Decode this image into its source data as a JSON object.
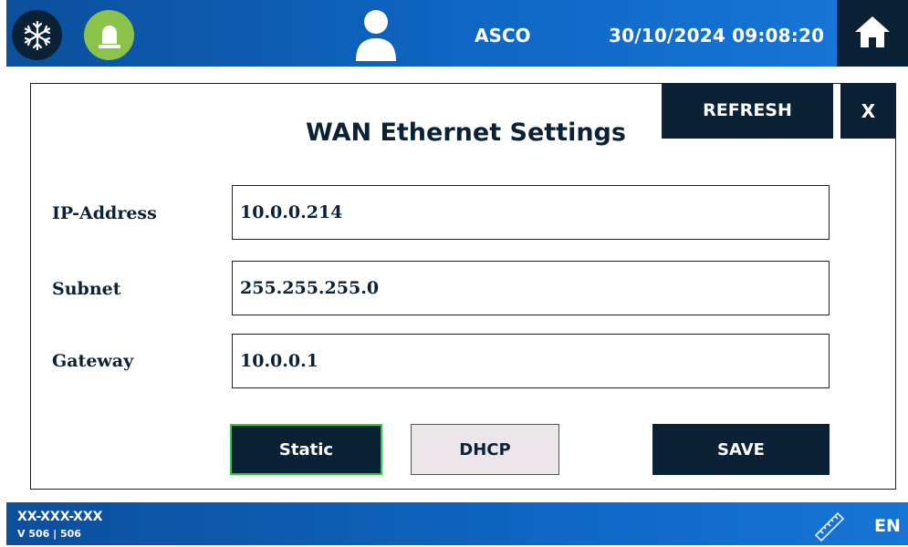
{
  "header": {
    "icons": [
      "snowflake-icon",
      "alarm-beacon-icon",
      "user-icon",
      "home-icon"
    ],
    "site_name": "ASCO",
    "datetime": "30/10/2024 09:08:20"
  },
  "dialog": {
    "title": "WAN Ethernet Settings",
    "refresh_label": "REFRESH",
    "close_label": "X",
    "fields": [
      {
        "label": "IP-Address",
        "value": "10.0.0.214"
      },
      {
        "label": "Subnet",
        "value": "255.255.255.0"
      },
      {
        "label": "Gateway",
        "value": "10.0.0.1"
      }
    ],
    "static_label": "Static",
    "dhcp_label": "DHCP",
    "save_label": "SAVE",
    "selected_mode": "Static"
  },
  "footer": {
    "device_id": "XX-XXX-XXX",
    "version": "V 506 | 506",
    "language": "EN"
  },
  "colors": {
    "navy": "#0b2236",
    "blue_bar": "#0f66c4",
    "alarm_green": "#8bc34a",
    "selected_border": "#2ecc40",
    "dhcp_bg": "#ece6ea"
  }
}
